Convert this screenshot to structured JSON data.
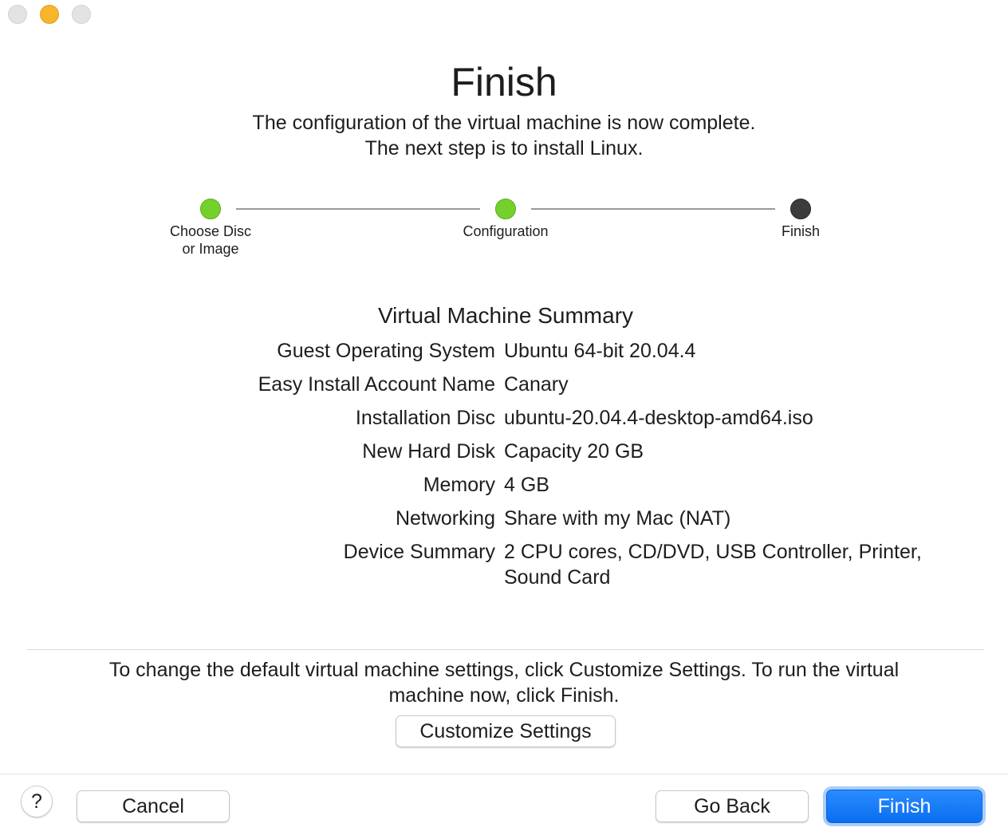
{
  "window": {
    "buttons": [
      {
        "name": "close-button",
        "color": "#e3e3e3"
      },
      {
        "name": "minimize-button",
        "color": "#f6b52a"
      },
      {
        "name": "zoom-button",
        "color": "#e3e3e3"
      }
    ]
  },
  "header": {
    "title": "Finish",
    "subtitle_line1": "The configuration of the virtual machine is now complete.",
    "subtitle_line2": "The next step is to install Linux."
  },
  "steps": [
    {
      "label": "Choose Disc\nor Image",
      "state": "done",
      "color": "#74d12c"
    },
    {
      "label": "Configuration",
      "state": "done",
      "color": "#74d12c"
    },
    {
      "label": "Finish",
      "state": "current",
      "color": "#3c3c3c"
    }
  ],
  "summary": {
    "title": "Virtual Machine Summary",
    "rows": [
      {
        "key": "Guest Operating System",
        "value": "Ubuntu 64-bit 20.04.4"
      },
      {
        "key": "Easy Install Account Name",
        "value": "Canary"
      },
      {
        "key": "Installation Disc",
        "value": "ubuntu-20.04.4-desktop-amd64.iso"
      },
      {
        "key": "New Hard Disk",
        "value": "Capacity 20 GB"
      },
      {
        "key": "Memory",
        "value": "4 GB"
      },
      {
        "key": "Networking",
        "value": "Share with my Mac (NAT)"
      },
      {
        "key": "Device Summary",
        "value": "2 CPU cores, CD/DVD, USB Controller, Printer, Sound Card"
      }
    ]
  },
  "hint": {
    "text": "To change the default virtual machine settings, click Customize Settings. To run the virtual machine now, click Finish."
  },
  "buttons": {
    "customize": "Customize Settings",
    "help": "?",
    "cancel": "Cancel",
    "go_back": "Go Back",
    "finish": "Finish",
    "accent_color": "#0a6ef0"
  }
}
